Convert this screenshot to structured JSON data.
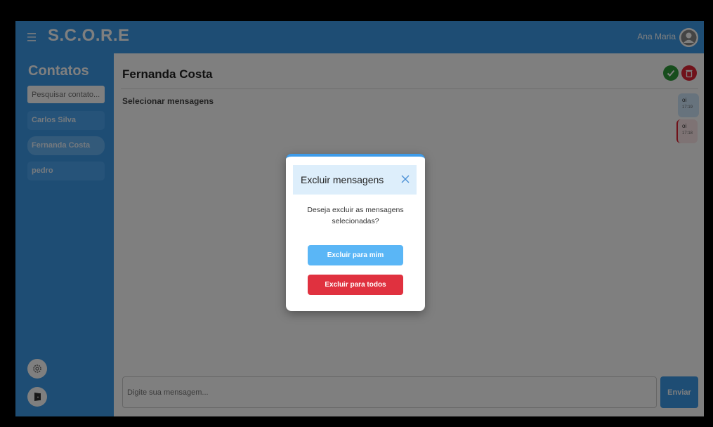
{
  "header": {
    "brand": "S.C.O.R.E",
    "user_name": "Ana Maria"
  },
  "sidebar": {
    "title": "Contatos",
    "search_placeholder": "Pesquisar contato...",
    "contacts": [
      {
        "label": "Carlos Silva"
      },
      {
        "label": "Fernanda Costa",
        "active": true
      },
      {
        "label": "pedro"
      }
    ]
  },
  "chat": {
    "contact_name": "Fernanda Costa",
    "select_messages_label": "Selecionar mensagens",
    "messages": [
      {
        "text": "oi",
        "time": "17:19"
      },
      {
        "text": "oi",
        "time": "17:18"
      }
    ],
    "composer_placeholder": "Digite sua mensagem...",
    "send_label": "Enviar"
  },
  "modal": {
    "title": "Excluir mensagens",
    "text": "Deseja excluir as mensagens selecionadas?",
    "delete_for_me_label": "Excluir para mim",
    "delete_for_all_label": "Excluir para todos"
  },
  "colors": {
    "accent": "#3d9be9",
    "danger": "#e0313f",
    "success": "#2e9a3a",
    "primary_button": "#5ab6f6"
  },
  "icons": [
    "menu-icon",
    "user-icon",
    "check-icon",
    "trash-icon",
    "gear-icon",
    "logout-icon",
    "close-icon"
  ]
}
